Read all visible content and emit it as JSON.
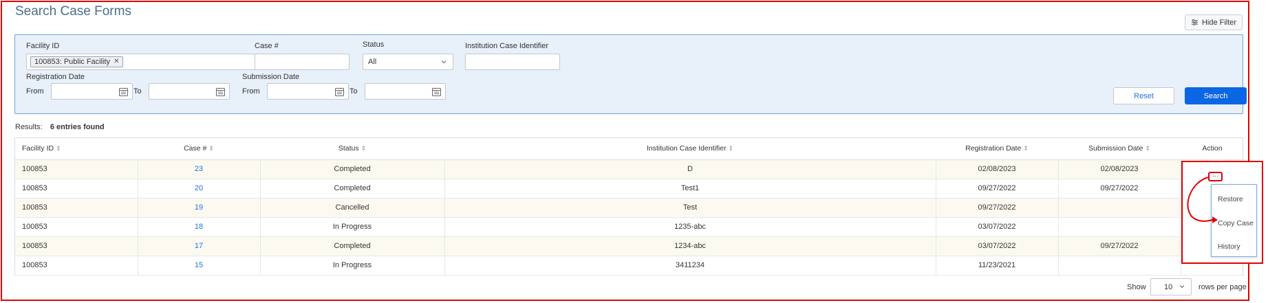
{
  "page": {
    "title": "Search Case Forms"
  },
  "toolbar": {
    "hide_filter_label": "Hide Filter",
    "hide_filter_icon": "sliders-icon"
  },
  "filters": {
    "facility_id_label": "Facility ID",
    "facility_tag": "100853: Public Facility",
    "case_label": "Case #",
    "case_value": "",
    "status_label": "Status",
    "status_value": "All",
    "institution_label": "Institution Case Identifier",
    "institution_value": "",
    "registration_label": "Registration Date",
    "submission_label": "Submission Date",
    "from_label": "From",
    "to_label": "To",
    "reset_label": "Reset",
    "search_label": "Search"
  },
  "results": {
    "label": "Results:",
    "count_text": "6 entries found"
  },
  "table": {
    "headers": [
      "Facility ID",
      "Case #",
      "Status",
      "Institution Case Identifier",
      "Registration Date",
      "Submission Date",
      "Action"
    ],
    "rows": [
      {
        "facility": "100853",
        "case": "23",
        "status": "Completed",
        "identifier": "D",
        "registration": "02/08/2023",
        "submission": "02/08/2023"
      },
      {
        "facility": "100853",
        "case": "20",
        "status": "Completed",
        "identifier": "Test1",
        "registration": "09/27/2022",
        "submission": "09/27/2022"
      },
      {
        "facility": "100853",
        "case": "19",
        "status": "Cancelled",
        "identifier": "Test",
        "registration": "09/27/2022",
        "submission": ""
      },
      {
        "facility": "100853",
        "case": "18",
        "status": "In Progress",
        "identifier": "1235-abc",
        "registration": "03/07/2022",
        "submission": ""
      },
      {
        "facility": "100853",
        "case": "17",
        "status": "Completed",
        "identifier": "1234-abc",
        "registration": "03/07/2022",
        "submission": "09/27/2022"
      },
      {
        "facility": "100853",
        "case": "15",
        "status": "In Progress",
        "identifier": "3411234",
        "registration": "11/23/2021",
        "submission": ""
      }
    ]
  },
  "pagination": {
    "show_label": "Show",
    "page_size": "10",
    "rows_per_page_label": "rows per page"
  },
  "action_menu": {
    "trigger": "...",
    "items": [
      "Restore",
      "Copy Case",
      "History"
    ]
  },
  "colors": {
    "accent": "#0b66e4",
    "link": "#1a73e8",
    "annotation": "#e00000",
    "panel_bg": "#e8f0fa"
  }
}
